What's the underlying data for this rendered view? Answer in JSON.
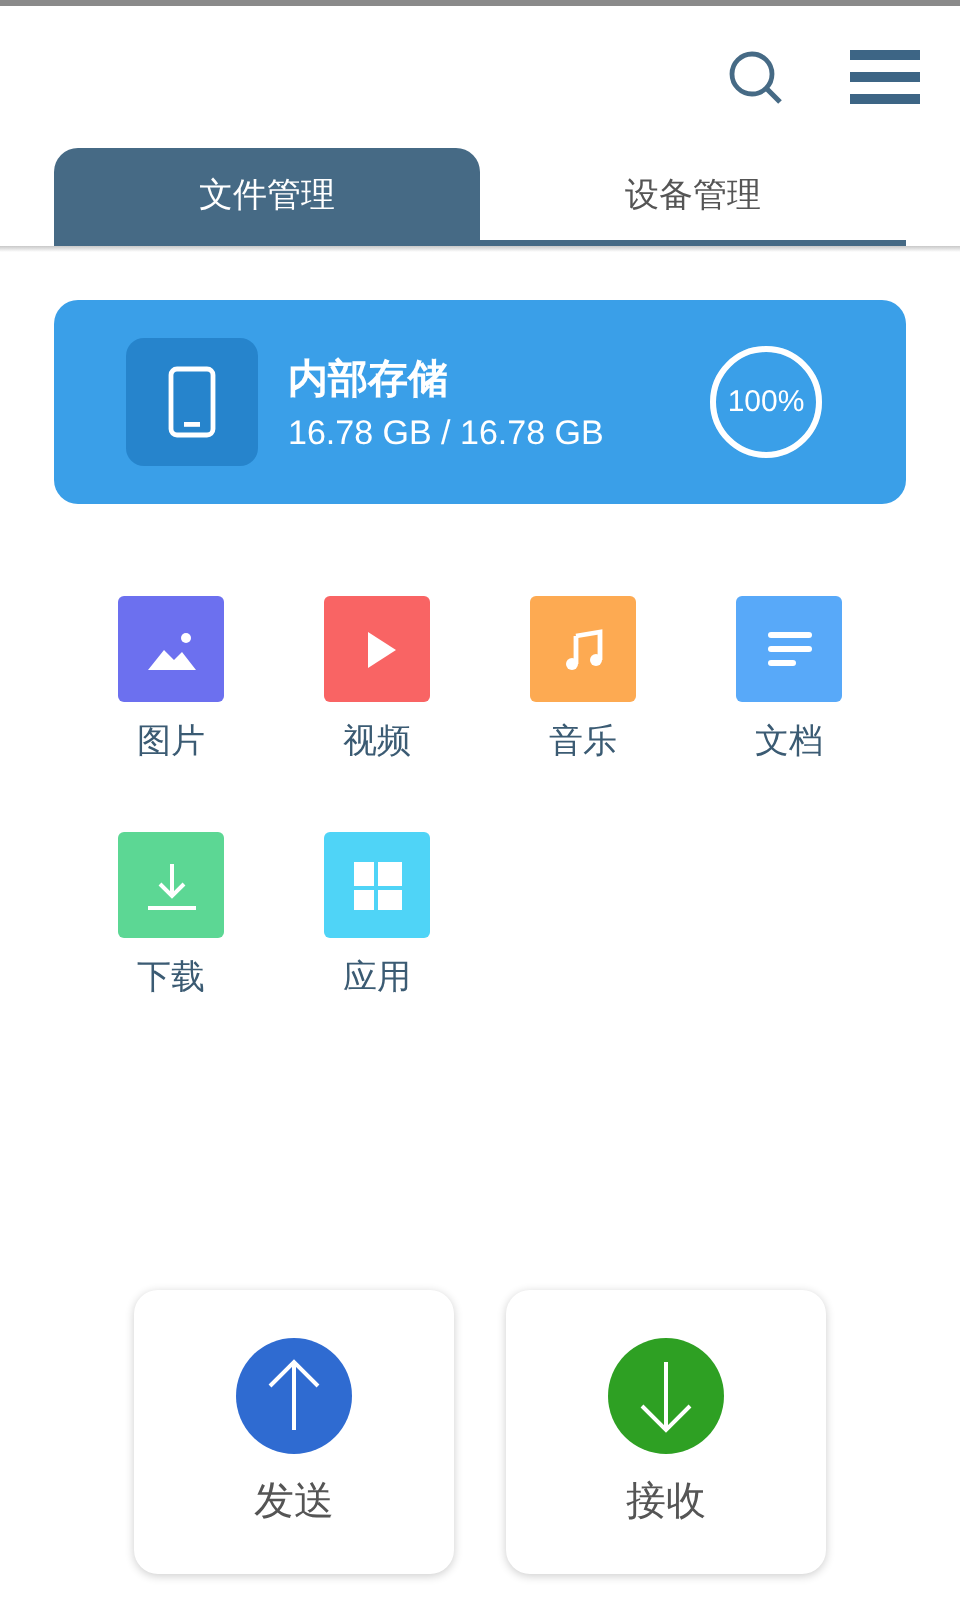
{
  "tabs": [
    {
      "label": "文件管理",
      "selected": true
    },
    {
      "label": "设备管理",
      "selected": false
    }
  ],
  "storage": {
    "title": "内部存储",
    "usage": "16.78 GB / 16.78 GB",
    "percent": "100%",
    "level": 1
  },
  "categories": [
    {
      "label": "图片",
      "kind": "image",
      "color": "#6c70ef"
    },
    {
      "label": "视频",
      "kind": "video",
      "color": "#f96464"
    },
    {
      "label": "音乐",
      "kind": "music",
      "color": "#fdaa52"
    },
    {
      "label": "文档",
      "kind": "document",
      "color": "#58a9f9"
    },
    {
      "label": "下载",
      "kind": "download",
      "color": "#5cd794"
    },
    {
      "label": "应用",
      "kind": "apps",
      "color": "#4fd4f7"
    }
  ],
  "actions": [
    {
      "label": "发送",
      "kind": "send",
      "color": "#2f6bd1"
    },
    {
      "label": "接收",
      "kind": "receive",
      "color": "#2ea023"
    }
  ]
}
